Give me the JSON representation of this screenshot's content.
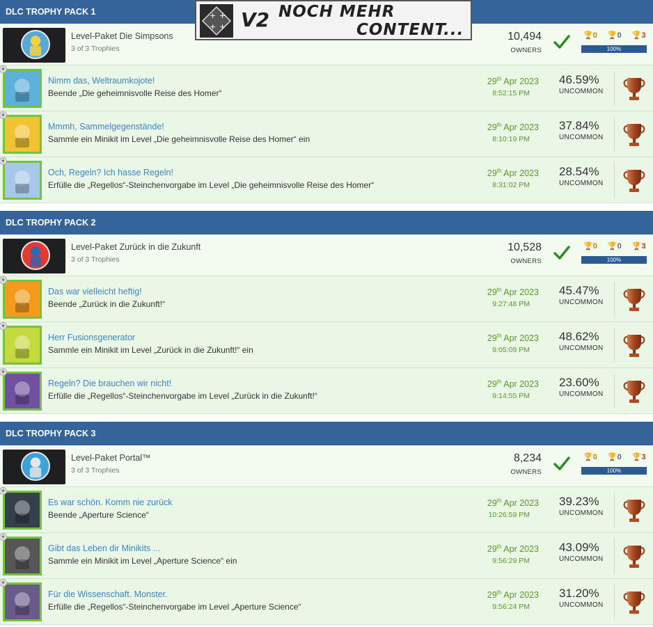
{
  "overlay": {
    "v2": "V2",
    "line1": "NOCH MEHR",
    "line2": "CONTENT..."
  },
  "packs": [
    {
      "header": "DLC TROPHY PACK 1",
      "title": "Level-Paket Die Simpsons",
      "subtitle": "3 of 3 Trophies",
      "owners": "10,494",
      "owners_label": "OWNERS",
      "gold": "0",
      "silver": "0",
      "bronze": "3",
      "progress": "100%",
      "trophies": [
        {
          "name": "Nimm das, Weltraumkojote!",
          "desc": "Beende „Die geheimnisvolle Reise des Homer“",
          "day": "29",
          "suffix": "th",
          "month_year": "Apr 2023",
          "time": "8:52:15 PM",
          "percent": "46.59%",
          "rarity": "UNCOMMON"
        },
        {
          "name": "Mmmh, Sammelgegenstände!",
          "desc": "Sammle ein Minikit im Level „Die geheimnisvolle Reise des Homer“ ein",
          "day": "29",
          "suffix": "th",
          "month_year": "Apr 2023",
          "time": "8:10:19 PM",
          "percent": "37.84%",
          "rarity": "UNCOMMON"
        },
        {
          "name": "Och, Regeln? Ich hasse Regeln!",
          "desc": "Erfülle die „Regellos“-Steinchenvorgabe im Level „Die geheimnisvolle Reise des Homer“",
          "day": "29",
          "suffix": "th",
          "month_year": "Apr 2023",
          "time": "8:31:02 PM",
          "percent": "28.54%",
          "rarity": "UNCOMMON"
        }
      ]
    },
    {
      "header": "DLC TROPHY PACK 2",
      "title": "Level-Paket Zurück in die Zukunft",
      "subtitle": "3 of 3 Trophies",
      "owners": "10,528",
      "owners_label": "OWNERS",
      "gold": "0",
      "silver": "0",
      "bronze": "3",
      "progress": "100%",
      "trophies": [
        {
          "name": "Das war vielleicht heftig!",
          "desc": "Beende „Zurück in die Zukunft!“",
          "day": "29",
          "suffix": "th",
          "month_year": "Apr 2023",
          "time": "9:27:48 PM",
          "percent": "45.47%",
          "rarity": "UNCOMMON"
        },
        {
          "name": "Herr Fusionsgenerator",
          "desc": "Sammle ein Minikit im Level „Zurück in die Zukunft!“ ein",
          "day": "29",
          "suffix": "th",
          "month_year": "Apr 2023",
          "time": "9:05:09 PM",
          "percent": "48.62%",
          "rarity": "UNCOMMON"
        },
        {
          "name": "Regeln? Die brauchen wir nicht!",
          "desc": "Erfülle die „Regellos“-Steinchenvorgabe im Level „Zurück in die Zukunft!“",
          "day": "29",
          "suffix": "th",
          "month_year": "Apr 2023",
          "time": "9:14:55 PM",
          "percent": "23.60%",
          "rarity": "UNCOMMON"
        }
      ]
    },
    {
      "header": "DLC TROPHY PACK 3",
      "title": "Level-Paket Portal™",
      "subtitle": "3 of 3 Trophies",
      "owners": "8,234",
      "owners_label": "OWNERS",
      "gold": "0",
      "silver": "0",
      "bronze": "3",
      "progress": "100%",
      "trophies": [
        {
          "name": "Es war schön. Komm nie zurück",
          "desc": "Beende „Aperture Science“",
          "day": "29",
          "suffix": "th",
          "month_year": "Apr 2023",
          "time": "10:26:59 PM",
          "percent": "39.23%",
          "rarity": "UNCOMMON"
        },
        {
          "name": "Gibt das Leben dir Minikits ...",
          "desc": "Sammle ein Minikit im Level „Aperture Science“ ein",
          "day": "29",
          "suffix": "th",
          "month_year": "Apr 2023",
          "time": "9:56:29 PM",
          "percent": "43.09%",
          "rarity": "UNCOMMON"
        },
        {
          "name": "Für die Wissenschaft. Monster.",
          "desc": "Erfülle die „Regellos“-Steinchenvorgabe im Level „Aperture Science“",
          "day": "29",
          "suffix": "th",
          "month_year": "Apr 2023",
          "time": "9:56:24 PM",
          "percent": "31.20%",
          "rarity": "UNCOMMON"
        }
      ]
    }
  ]
}
